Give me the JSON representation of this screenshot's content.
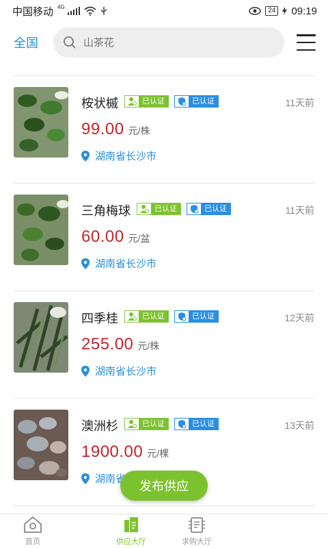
{
  "status_bar": {
    "carrier": "中国移动",
    "network": "4G",
    "battery": "24",
    "time": "09:19"
  },
  "header": {
    "region": "全国",
    "search_placeholder": "山茶花"
  },
  "list": [
    {
      "name": "桉状槭",
      "price": "99.00",
      "unit": "元/株",
      "location": "湖南省长沙市",
      "time": "11天前",
      "badge_personal": "已认证",
      "badge_company": "已认证"
    },
    {
      "name": "三角梅球",
      "price": "60.00",
      "unit": "元/盆",
      "location": "湖南省长沙市",
      "time": "11天前",
      "badge_personal": "已认证",
      "badge_company": "已认证"
    },
    {
      "name": "四季桂",
      "price": "255.00",
      "unit": "元/株",
      "location": "湖南省长沙市",
      "time": "12天前",
      "badge_personal": "已认证",
      "badge_company": "已认证"
    },
    {
      "name": "澳洲杉",
      "price": "1900.00",
      "unit": "元/棵",
      "location": "湖南省长沙市",
      "time": "13天前",
      "badge_personal": "已认证",
      "badge_company": "已认证"
    }
  ],
  "fab": {
    "label": "发布供应"
  },
  "bottom_nav": [
    {
      "label": "首页"
    },
    {
      "label": "供应大厅"
    },
    {
      "label": "求购大厅"
    }
  ],
  "colors": {
    "accent_green": "#7cc22e",
    "accent_blue": "#2b8fd6",
    "price_red": "#c0272d"
  }
}
